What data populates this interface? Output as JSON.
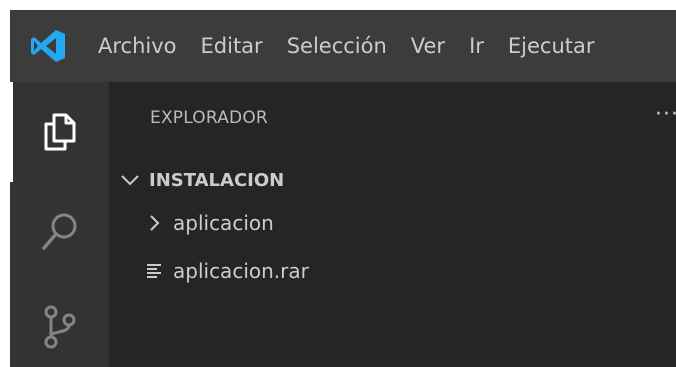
{
  "menu": {
    "items": [
      "Archivo",
      "Editar",
      "Selección",
      "Ver",
      "Ir",
      "Ejecutar"
    ]
  },
  "sidebar": {
    "title": "EXPLORADOR",
    "more_actions": "···",
    "folder": "INSTALACION",
    "items": [
      {
        "label": "aplicacion",
        "type": "folder",
        "expanded": false
      },
      {
        "label": "aplicacion.rar",
        "type": "file"
      }
    ]
  },
  "colors": {
    "titlebar": "#3c3c3c",
    "activity_bar": "#333333",
    "sidebar": "#252526",
    "text": "#cccccc",
    "logo": "#23a9f2"
  },
  "icons": [
    "vscode-logo-icon",
    "explorer-icon",
    "search-icon",
    "source-control-icon",
    "chevron-down-icon",
    "chevron-right-icon",
    "file-lines-icon"
  ]
}
